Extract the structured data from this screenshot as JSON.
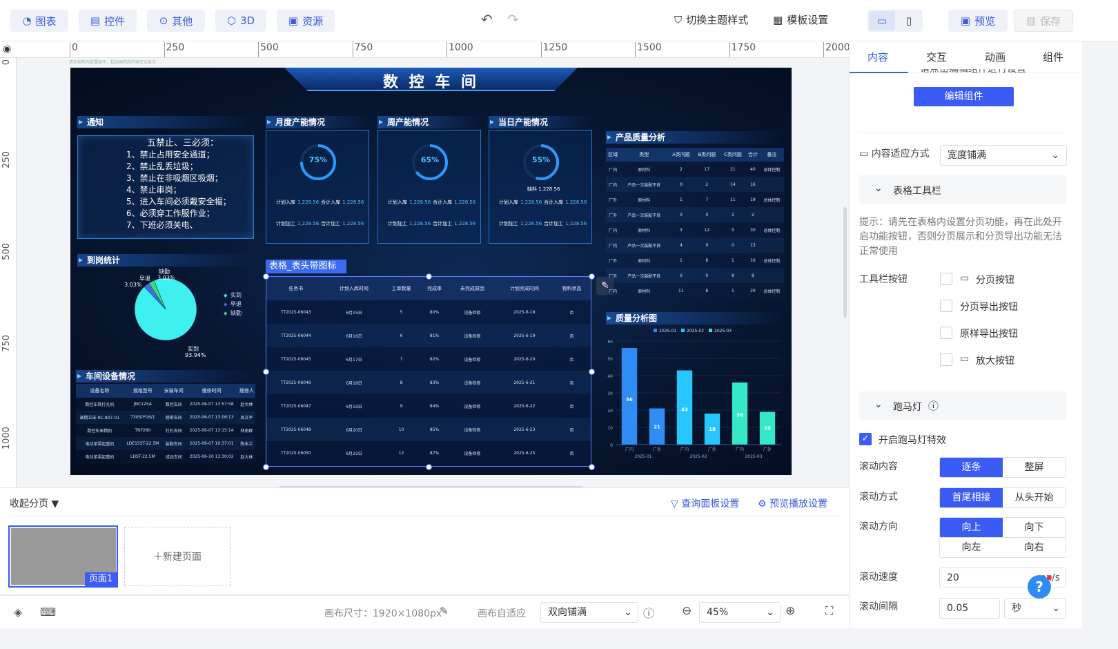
{
  "toolbar": {
    "tabs": [
      {
        "label": "图表",
        "icon": "chart-icon"
      },
      {
        "label": "控件",
        "icon": "widget-icon"
      },
      {
        "label": "其他",
        "icon": "more-icon"
      },
      {
        "label": "3D",
        "icon": "cube-icon"
      },
      {
        "label": "资源",
        "icon": "resource-icon"
      }
    ],
    "theme_label": "切换主题样式",
    "template_label": "模板设置",
    "preview_label": "预览",
    "save_label": "保存"
  },
  "ruler": {
    "h_labels": [
      "0",
      "250",
      "500",
      "750",
      "1000",
      "1250",
      "1500",
      "1750",
      "2000"
    ],
    "v_labels": [
      "0",
      "250",
      "500",
      "750",
      "1000"
    ]
  },
  "canvas_hint": "请在画布内放置组件，超出画布的内容无法显示",
  "dashboard": {
    "title": "数 控 车 间",
    "notice": {
      "title": "通知",
      "heading": "五禁止、三必须：",
      "lines": [
        "1、禁止占用安全通道；",
        "2、禁止乱丢垃圾；",
        "3、禁止在非吸烟区吸烟；",
        "4、禁止串岗；",
        "5、进入车间必须戴安全帽；",
        "6、必须穿工作服作业；",
        "7、下班必须关电、"
      ]
    },
    "gauges": [
      {
        "title": "月度产能情况",
        "percent": "75%",
        "value": 0.75,
        "line1": [
          "计划入库",
          "1,228.56",
          "合计入库",
          "1,228.56"
        ],
        "line2": [
          "计划加工",
          "1,228.56",
          "合计加工",
          "1,228.56"
        ],
        "extra": ""
      },
      {
        "title": "周产能情况",
        "percent": "65%",
        "value": 0.65,
        "line1": [
          "计划入库",
          "1,228.56",
          "合计入库",
          "1,228.56"
        ],
        "line2": [
          "计划加工",
          "1,228.56",
          "合计加工",
          "1,228.56"
        ],
        "extra": ""
      },
      {
        "title": "当日产能情况",
        "percent": "55%",
        "value": 0.55,
        "line1": [
          "计划入库",
          "1,228.56",
          "合计入库",
          "1,228.56"
        ],
        "line2": [
          "计划加工",
          "1,228.56",
          "合计加工",
          "1,228.56"
        ],
        "extra": "缺料 1,228.56"
      }
    ],
    "attendance": {
      "title": "到岗统计",
      "labels": [
        {
          "name": "缺勤",
          "pct": "3.03%"
        },
        {
          "name": "早退",
          "pct": "3.03%"
        },
        {
          "name": "实到",
          "pct": "93.94%"
        }
      ],
      "legend": [
        "实到",
        "早退",
        "缺勤"
      ]
    },
    "equipment": {
      "title": "车间设备情况",
      "headers": [
        "设备名称",
        "规格型号",
        "安装车间",
        "维修时间",
        "维修人"
      ],
      "rows": [
        [
          "数控车铣打孔机",
          "JNC125A",
          "数控车间",
          "2025-06-07 13:57:58",
          "赵大林"
        ],
        [
          "高精立床 RC-807-01",
          "730S0*16/1",
          "精密车间",
          "2025-06-07 13:06:13",
          "周文平"
        ],
        [
          "数控车床精机",
          "TNF280",
          "打孔车间",
          "2025-06-07 13:15:14",
          "林南群"
        ],
        [
          "电动单梁起重机",
          "LDE15ST-22.5M",
          "装配车间",
          "2025-06-07 10:37:01",
          "陈永兰"
        ],
        [
          "电动单梁起重机",
          "LDST-22.5M",
          "成品车间",
          "2025-06-10 13:30:02",
          "赵大林"
        ]
      ]
    },
    "task_table": {
      "badge": "表格_表头带图标",
      "headers": [
        "任务书",
        "计划入库时间",
        "工单数量",
        "完成率",
        "未完成原因",
        "计划完成时间",
        "物料状态"
      ],
      "rows": [
        [
          "TT2025-06043",
          "6月15日",
          "5",
          "80%",
          "设备检修",
          "2025-6-18",
          "否"
        ],
        [
          "TT2025-06044",
          "6月16日",
          "6",
          "81%",
          "设备检修",
          "2025-6-19",
          "否"
        ],
        [
          "TT2025-06045",
          "6月17日",
          "7",
          "82%",
          "设备检修",
          "2025-6-20",
          "否"
        ],
        [
          "TT2025-06046",
          "6月18日",
          "8",
          "83%",
          "设备检修",
          "2025-6-21",
          "否"
        ],
        [
          "TT2025-06047",
          "6月19日",
          "9",
          "84%",
          "设备检修",
          "2025-6-22",
          "否"
        ],
        [
          "TT2025-06048",
          "6月20日",
          "10",
          "85%",
          "设备检修",
          "2025-6-23",
          "否"
        ],
        [
          "TT2025-06050",
          "6月22日",
          "12",
          "87%",
          "设备检修",
          "2025-6-25",
          "否"
        ]
      ]
    },
    "quality_table": {
      "title": "产品质量分析",
      "headers": [
        "区域",
        "类型",
        "A类问题",
        "B类问题",
        "C类问题",
        "合计",
        "备注"
      ],
      "rows": [
        [
          "厂内",
          "原材料",
          "2",
          "17",
          "21",
          "40",
          "总体控制"
        ],
        [
          "厂内",
          "产品一次装配不良",
          "0",
          "2",
          "14",
          "16",
          ""
        ],
        [
          "厂外",
          "原材料",
          "1",
          "7",
          "11",
          "19",
          "总体控制"
        ],
        [
          "厂外",
          "产品一次装配不良",
          "0",
          "0",
          "2",
          "2",
          ""
        ],
        [
          "厂内",
          "原材料",
          "3",
          "12",
          "5",
          "30",
          "总体控制"
        ],
        [
          "厂内",
          "产品一次装配不良",
          "4",
          "9",
          "0",
          "13",
          ""
        ],
        [
          "厂外",
          "原材料",
          "1",
          "8",
          "1",
          "10",
          "总体控制"
        ],
        [
          "厂外",
          "产品一次装配不良",
          "0",
          "0",
          "8",
          "8",
          ""
        ],
        [
          "厂内",
          "原材料",
          "11",
          "8",
          "1",
          "20",
          "总体控制"
        ]
      ]
    }
  },
  "chart_data": [
    {
      "type": "pie",
      "title": "到岗统计",
      "categories": [
        "实到",
        "早退",
        "缺勤"
      ],
      "values": [
        93.94,
        3.03,
        3.03
      ],
      "colors": [
        "#3ff0f0",
        "#3f6ee8",
        "#3ddc84"
      ]
    },
    {
      "type": "bar",
      "title": "质量分析图",
      "series": [
        {
          "name": "2025-01",
          "values": [
            56,
            21,
            null,
            null,
            null,
            null
          ],
          "color": "#2f8cf5"
        },
        {
          "name": "2025-02",
          "values": [
            null,
            null,
            43,
            18,
            null,
            null
          ],
          "color": "#27c6ff"
        },
        {
          "name": "2025-03",
          "values": [
            null,
            null,
            null,
            null,
            36,
            19
          ],
          "color": "#34e8c8"
        }
      ],
      "categories": [
        "厂内",
        "厂外",
        "厂内",
        "厂外",
        "厂内",
        "厂外"
      ],
      "groups": [
        "2025-01",
        "2025-02",
        "2025-03"
      ],
      "yticks": [
        0,
        10,
        20,
        30,
        40,
        50,
        60
      ],
      "ylim": [
        0,
        60
      ]
    }
  ],
  "pages": {
    "collapse_label": "收起分页",
    "query_panel_label": "查询面板设置",
    "preview_play_label": "预览播放设置",
    "page_name": "页面1",
    "new_page_label": "新建页面"
  },
  "status": {
    "canvas_size": "画布尺寸：1920×1080px",
    "autofit_label": "画布自适应",
    "autofit_value": "双向铺满",
    "zoom": "45%"
  },
  "right_panel": {
    "tabs": [
      "内容",
      "交互",
      "动画",
      "组件"
    ],
    "cut_text": "请点击编辑组件进行设置",
    "edit_button": "编辑组件",
    "fit_label": "内容适应方式",
    "fit_value": "宽度铺满",
    "toolbar_section": "表格工具栏",
    "hint": "提示：请先在表格内设置分页功能，再在此处开启功能按钮，否则分页展示和分页导出功能无法正常使用",
    "toolbar_btn_label": "工具栏按钮",
    "options": [
      "分页按钮",
      "分页导出按钮",
      "原样导出按钮",
      "放大按钮"
    ],
    "marquee_section": "跑马灯",
    "marquee_enable": "开启跑马灯特效",
    "scroll_content_label": "滚动内容",
    "scroll_content": [
      "逐条",
      "整屏"
    ],
    "scroll_mode_label": "滚动方式",
    "scroll_mode": [
      "首尾相接",
      "从头开始"
    ],
    "scroll_dir_label": "滚动方向",
    "scroll_dir": [
      "向上",
      "向下",
      "向左",
      "向右"
    ],
    "speed_label": "滚动速度",
    "speed_value": "20",
    "speed_unit": "px/s",
    "interval_label": "滚动间隔",
    "interval_value": "0.05",
    "interval_unit": "秒"
  }
}
